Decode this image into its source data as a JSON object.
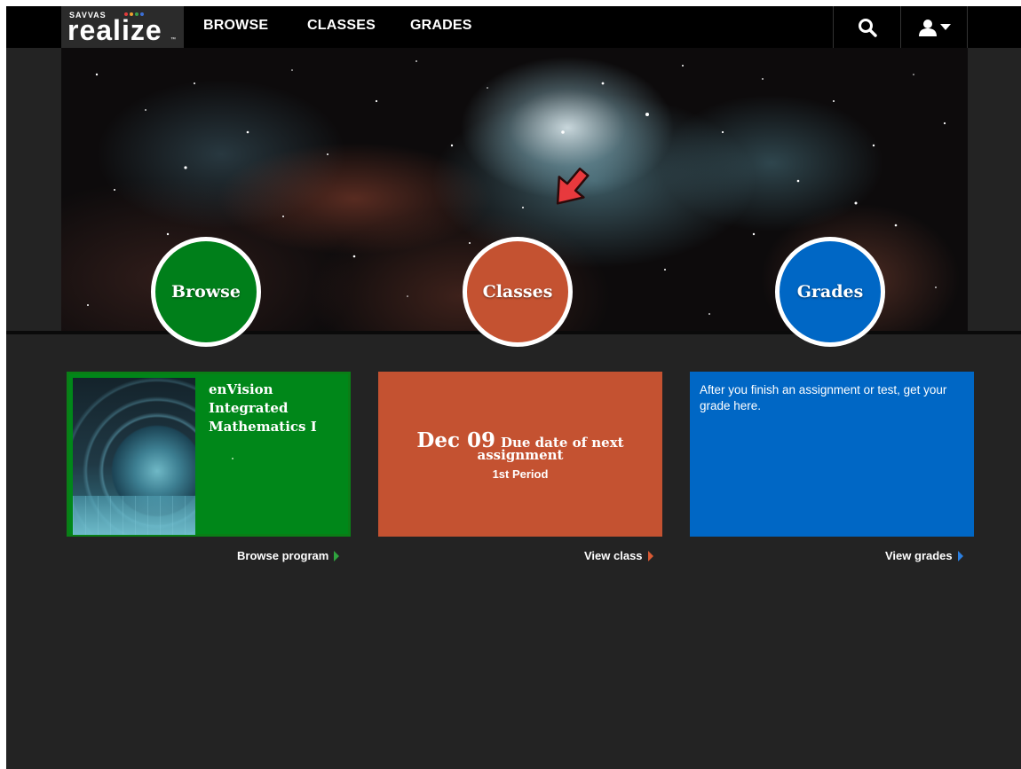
{
  "logo": {
    "brand_small": "SAVVAS",
    "brand_big": "realize",
    "trademark": "™",
    "dot_colors": [
      "#e23b3b",
      "#f0a030",
      "#3aa14a",
      "#3b6fd6"
    ]
  },
  "nav": {
    "browse": "BROWSE",
    "classes": "CLASSES",
    "grades": "GRADES",
    "search_icon": "search-icon",
    "user_icon": "user-icon"
  },
  "circles": {
    "browse": "Browse",
    "classes": "Classes",
    "grades": "Grades"
  },
  "browse_card": {
    "program_title": "enVision Integrated Mathematics I",
    "link": "Browse program"
  },
  "classes_card": {
    "due_date": "Dec 09",
    "due_label_part1": "Due date of next",
    "due_label_part2": "assignment",
    "period": "1st Period",
    "link": "View class"
  },
  "grades_card": {
    "message": "After you finish an assignment or test, get your grade here.",
    "link": "View grades"
  },
  "colors": {
    "browse": "#007f1a",
    "classes": "#c45231",
    "grades": "#0067c5",
    "background": "#232323"
  }
}
